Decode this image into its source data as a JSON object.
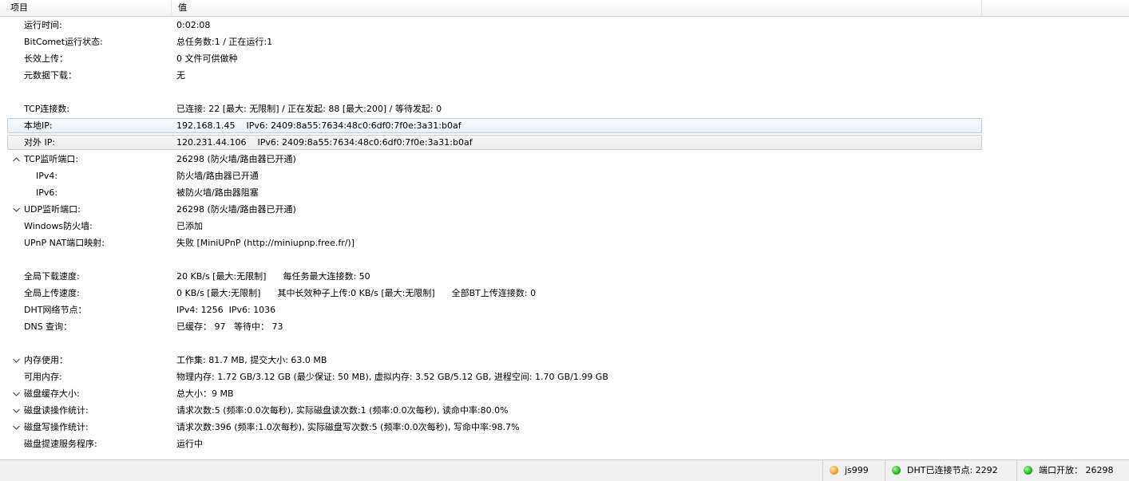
{
  "header": {
    "col_key": "项目",
    "col_value": "值"
  },
  "rows": [
    {
      "key": "运行时间:",
      "value": "0:02:08",
      "indent": 1,
      "toggle": "none"
    },
    {
      "key": "BitComet运行状态:",
      "value": "总任务数:1 / 正在运行:1",
      "indent": 1,
      "toggle": "none"
    },
    {
      "key": "长效上传：",
      "value": "0 文件可供做种",
      "indent": 1,
      "toggle": "none"
    },
    {
      "key": "元数据下载：",
      "value": "无",
      "indent": 1,
      "toggle": "none"
    },
    {
      "key": "",
      "value": "",
      "indent": 1,
      "toggle": "none"
    },
    {
      "key": "TCP连接数:",
      "value": "已连接: 22 [最大: 无限制] / 正在发起: 88 [最大:200] / 等待发起: 0",
      "indent": 1,
      "toggle": "none"
    },
    {
      "key": "本地IP:",
      "value": "192.168.1.45    IPv6: 2409:8a55:7634:48c0:6df0:7f0e:3a31:b0af",
      "indent": 1,
      "toggle": "none",
      "state": "selected"
    },
    {
      "key": "对外 IP:",
      "value": "120.231.44.106    IPv6: 2409:8a55:7634:48c0:6df0:7f0e:3a31:b0af",
      "indent": 1,
      "toggle": "none",
      "state": "hover"
    },
    {
      "key": "TCP监听端口:",
      "value": "26298 (防火墙/路由器已开通)",
      "indent": 1,
      "toggle": "expanded"
    },
    {
      "key": "IPv4:",
      "value": "防火墙/路由器已开通",
      "indent": 2,
      "toggle": "none"
    },
    {
      "key": "IPv6:",
      "value": "被防火墙/路由器阻塞",
      "indent": 2,
      "toggle": "none"
    },
    {
      "key": "UDP监听端口:",
      "value": "26298 (防火墙/路由器已开通)",
      "indent": 1,
      "toggle": "collapsed"
    },
    {
      "key": "Windows防火墙:",
      "value": "已添加",
      "indent": 1,
      "toggle": "none"
    },
    {
      "key": "UPnP NAT端口映射:",
      "value": "失败 [MiniUPnP (http://miniupnp.free.fr/)]",
      "indent": 1,
      "toggle": "none"
    },
    {
      "key": "",
      "value": "",
      "indent": 1,
      "toggle": "none"
    },
    {
      "key": "全局下载速度:",
      "value": "20 KB/s [最大:无限制]      每任务最大连接数: 50",
      "indent": 1,
      "toggle": "none"
    },
    {
      "key": "全局上传速度:",
      "value": "0 KB/s [最大:无限制]      其中长效种子上传:0 KB/s [最大:无限制]      全部BT上传连接数: 0",
      "indent": 1,
      "toggle": "none"
    },
    {
      "key": "DHT网络节点：",
      "value": "IPv4: 1256  IPv6: 1036",
      "indent": 1,
      "toggle": "none"
    },
    {
      "key": "DNS 查询：",
      "value": "已缓存： 97   等待中： 73",
      "indent": 1,
      "toggle": "none"
    },
    {
      "key": "",
      "value": "",
      "indent": 1,
      "toggle": "none"
    },
    {
      "key": "内存使用：",
      "value": "工作集: 81.7 MB, 提交大小: 63.0 MB",
      "indent": 1,
      "toggle": "collapsed"
    },
    {
      "key": "可用内存:",
      "value": "物理内存: 1.72 GB/3.12 GB (最少保证: 50 MB), 虚拟内存: 3.52 GB/5.12 GB, 进程空间: 1.70 GB/1.99 GB",
      "indent": 1,
      "toggle": "none"
    },
    {
      "key": "磁盘缓存大小:",
      "value": "总大小：9 MB",
      "indent": 1,
      "toggle": "collapsed"
    },
    {
      "key": "磁盘读操作统计:",
      "value": "请求次数:5 (频率:0.0次每秒), 实际磁盘读次数:1 (频率:0.0次每秒), 读命中率:80.0%",
      "indent": 1,
      "toggle": "collapsed"
    },
    {
      "key": "磁盘写操作统计:",
      "value": "请求次数:396 (频率:1.0次每秒), 实际磁盘写次数:5 (频率:0.0次每秒), 写命中率:98.7%",
      "indent": 1,
      "toggle": "collapsed"
    },
    {
      "key": "磁盘提速服务程序:",
      "value": "运行中",
      "indent": 1,
      "toggle": "none"
    }
  ],
  "statusbar": {
    "user_icon": "user-status-icon",
    "user": "js999",
    "dht_icon": "dht-status-icon",
    "dht_text": "DHT已连接节点: 2292",
    "port_icon": "port-status-icon",
    "port_text": "端口开放： 26298"
  },
  "colors": {
    "selected_border": "#b6cfe2",
    "dot_orange": "#f0a22a",
    "dot_green": "#22b41b"
  }
}
